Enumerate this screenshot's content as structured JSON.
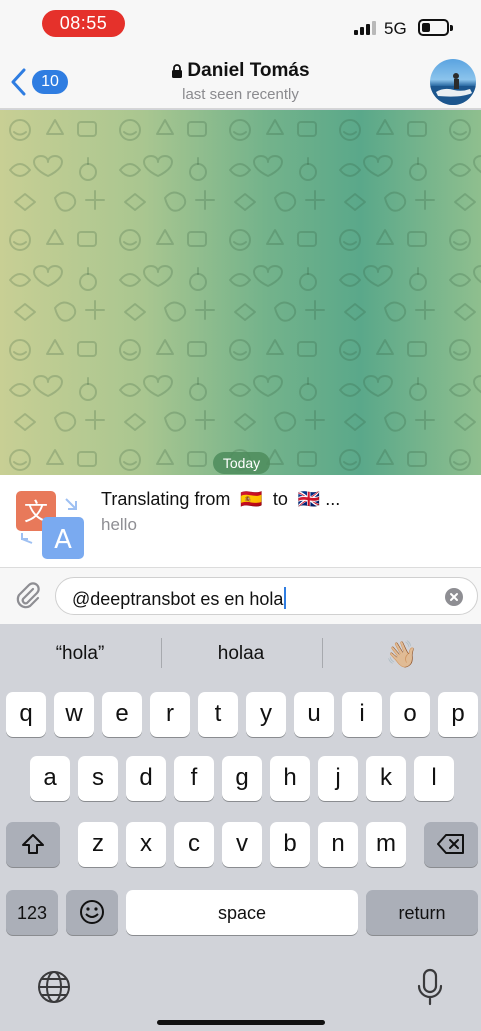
{
  "status_bar": {
    "time": "08:55",
    "network": "5G"
  },
  "header": {
    "back_count": "10",
    "title": "Daniel Tomás",
    "subtitle": "last seen recently"
  },
  "chat": {
    "date_badge": "Today"
  },
  "inline_bot": {
    "title_prefix": "Translating from",
    "from_flag": "🇪🇸",
    "connector": "to",
    "to_flag": "🇬🇧",
    "ellipsis": "...",
    "preview": "hello"
  },
  "composer": {
    "value": "@deeptransbot es en hola"
  },
  "keyboard": {
    "suggestions": [
      "“hola”",
      "holaa",
      "👋🏼"
    ],
    "row1": [
      "q",
      "w",
      "e",
      "r",
      "t",
      "y",
      "u",
      "i",
      "o",
      "p"
    ],
    "row2": [
      "a",
      "s",
      "d",
      "f",
      "g",
      "h",
      "j",
      "k",
      "l"
    ],
    "row3": [
      "z",
      "x",
      "c",
      "v",
      "b",
      "n",
      "m"
    ],
    "numbers_label": "123",
    "space_label": "space",
    "return_label": "return"
  },
  "colors": {
    "accent": "#2f7de1",
    "time_pill": "#e5312b"
  }
}
